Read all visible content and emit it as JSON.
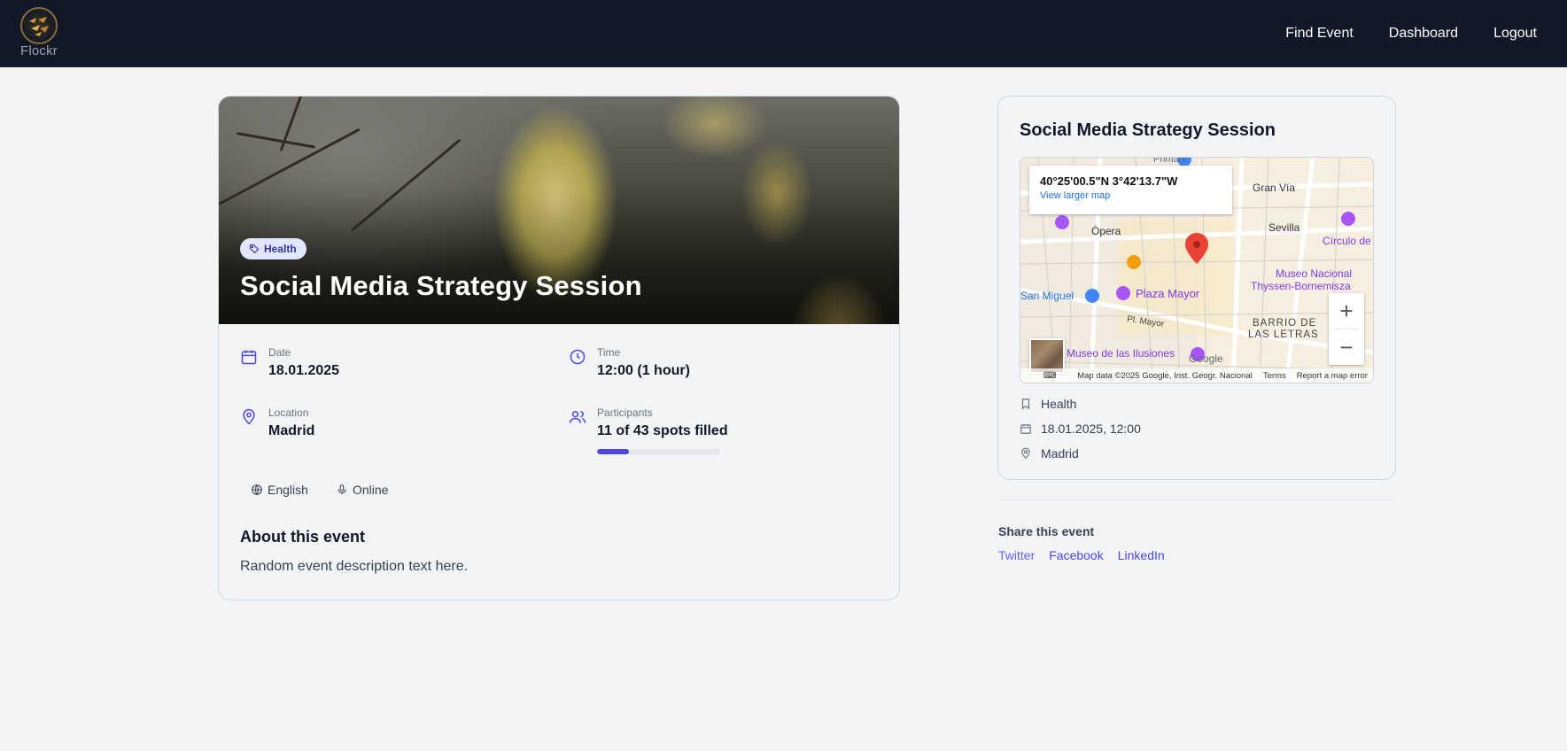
{
  "nav": {
    "logo_text": "Flockr",
    "links": [
      "Find Event",
      "Dashboard",
      "Logout"
    ]
  },
  "event": {
    "category": "Health",
    "title": "Social Media Strategy Session",
    "date_label": "Date",
    "date_value": "18.01.2025",
    "time_label": "Time",
    "time_value": "12:00 (1 hour)",
    "location_label": "Location",
    "location_value": "Madrid",
    "participants_label": "Participants",
    "participants_value": "11 of 43 spots filled",
    "participants_filled": 11,
    "participants_total": 43,
    "language": "English",
    "format": "Online",
    "about_title": "About this event",
    "about_text": "Random event description text here."
  },
  "side": {
    "title": "Social Media Strategy Session",
    "category": "Health",
    "datetime": "18.01.2025, 12:00",
    "location": "Madrid"
  },
  "map": {
    "coordinates": "40°25'00.5\"N 3°42'13.7\"W",
    "view_larger": "View larger map",
    "labels": [
      "Primark",
      "Gran Vía",
      "Ópera",
      "Sevilla",
      "Círculo de",
      "Museo Nacional",
      "Thyssen-Bornemisza",
      "San Miguel",
      "Plaza Mayor",
      "Pl. Mayor",
      "BARRIO DE",
      "LAS LETRAS",
      "Museo de las Ilusiones",
      "Google"
    ],
    "footer": {
      "data": "Map data ©2025 Google, Inst. Geogr. Nacional",
      "terms": "Terms",
      "report": "Report a map error"
    },
    "zoom_in": "+",
    "zoom_out": "−"
  },
  "share": {
    "title": "Share this event",
    "links": [
      "Twitter",
      "Facebook",
      "LinkedIn"
    ]
  },
  "colors": {
    "nav_bg": "#111827",
    "accent": "#4f46e5",
    "badge_bg": "#e0e7ff",
    "page_bg": "#f3f4f6"
  }
}
